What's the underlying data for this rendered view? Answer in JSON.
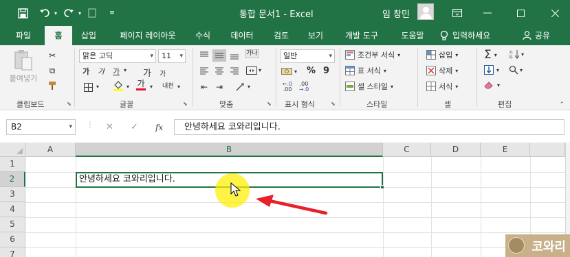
{
  "titlebar": {
    "title": "통합 문서1  -  Excel",
    "user": "임 창민",
    "icons": [
      "save-icon",
      "undo-icon",
      "redo-icon",
      "touch-mode-icon",
      "customize-qat-icon",
      "ribbon-display-icon",
      "minimize-icon",
      "maximize-icon",
      "close-icon"
    ]
  },
  "tabs": [
    {
      "label": "파일"
    },
    {
      "label": "홈"
    },
    {
      "label": "삽입"
    },
    {
      "label": "페이지 레이아웃"
    },
    {
      "label": "수식"
    },
    {
      "label": "데이터"
    },
    {
      "label": "검토"
    },
    {
      "label": "보기"
    },
    {
      "label": "개발 도구"
    },
    {
      "label": "도움말"
    }
  ],
  "tell_me": "입력하세요",
  "share": "공유",
  "ribbon": {
    "clipboard": {
      "paste": "붙여넣기",
      "label": "클립보드"
    },
    "font": {
      "name": "맑은 고딕",
      "size": "11",
      "label": "글꼴",
      "bold": "가",
      "italic": "가",
      "underline": "가",
      "grow": "가",
      "shrink": "가",
      "phonetic": "내천"
    },
    "alignment": {
      "label": "맞춤",
      "wrap": "가나"
    },
    "number": {
      "format": "일반",
      "percent": "%",
      "comma": "9",
      "label": "표시 형식"
    },
    "styles": {
      "conditional": "조건부 서식",
      "table": "표 서식",
      "cell": "셀 스타일",
      "label": "스타일"
    },
    "cells": {
      "insert": "삽입",
      "delete": "삭제",
      "format": "서식",
      "label": "셀"
    },
    "editing": {
      "label": "편집"
    }
  },
  "formula_bar": {
    "name_box": "B2",
    "fx": "fx",
    "content": "안녕하세요 코와리입니다."
  },
  "sheet": {
    "columns": [
      "A",
      "B",
      "C",
      "D",
      "E"
    ],
    "rows": [
      "1",
      "2",
      "3",
      "4",
      "5",
      "6",
      "7"
    ],
    "active_cell": "B2",
    "cells": {
      "B2": "안녕하세요 코와리입니다."
    }
  },
  "watermark": "코와리",
  "colors": {
    "excel_green": "#217346",
    "ribbon_bg": "#f3f3f3",
    "header_bg": "#e6e6e6",
    "highlight": "#ffee00",
    "arrow": "#e8202a",
    "font_color_bar": "#e81123",
    "fill_color_bar": "#ffff00"
  }
}
